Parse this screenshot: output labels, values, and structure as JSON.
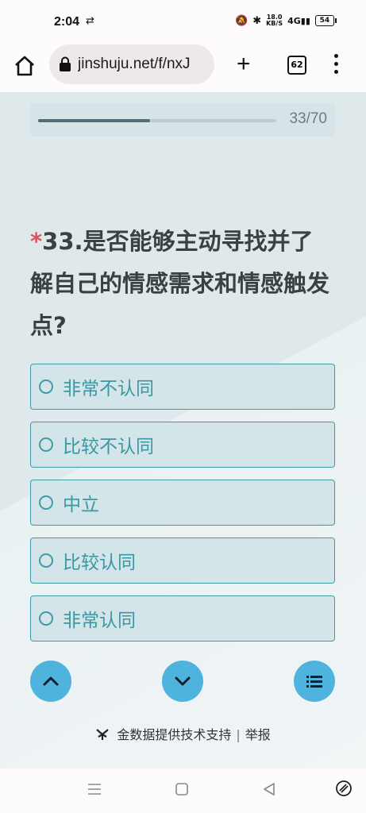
{
  "status": {
    "time": "2:04",
    "net_speed_top": "18.0",
    "net_speed_bottom": "KB/S",
    "network": "4G",
    "battery": "54"
  },
  "browser": {
    "url": "jinshuju.net/f/nxJ",
    "tab_count": "62"
  },
  "progress": {
    "text": "33/70",
    "fraction": 0.471
  },
  "question": {
    "required_mark": "*",
    "number": "33.",
    "text": "是否能够主动寻找并了解自己的情感需求和情感触发点?"
  },
  "options": [
    {
      "label": "非常不认同"
    },
    {
      "label": "比较不认同"
    },
    {
      "label": "中立"
    },
    {
      "label": "比较认同"
    },
    {
      "label": "非常认同"
    }
  ],
  "footer": {
    "credit": "金数据提供技术支持",
    "separator": "|",
    "report": "举报"
  },
  "colors": {
    "accent": "#3f9aa6",
    "fab": "#4eb3dd",
    "required": "#e0505a"
  }
}
